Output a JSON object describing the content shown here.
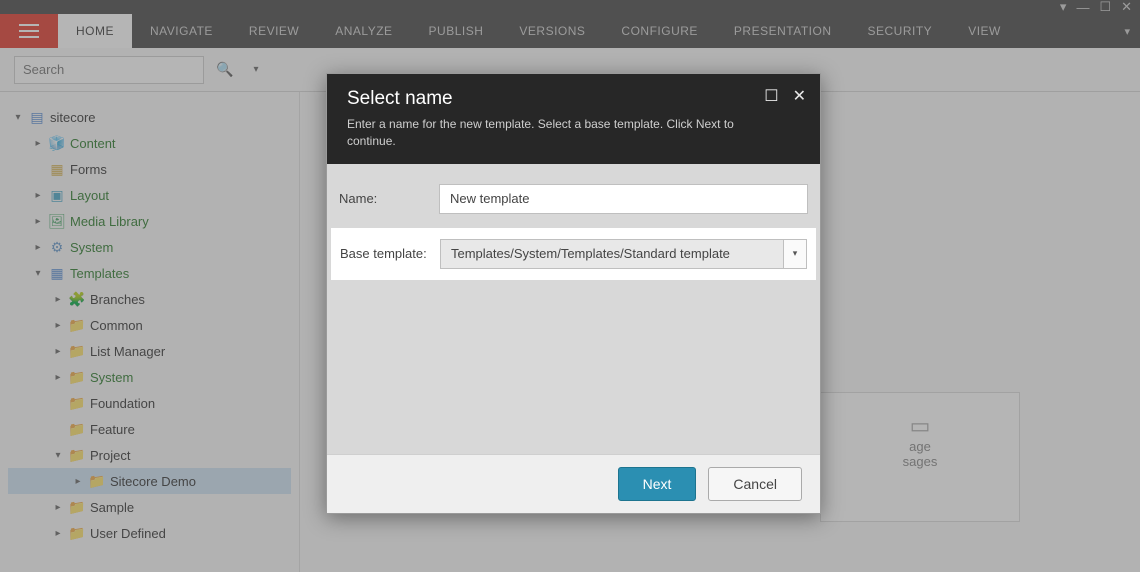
{
  "window": {
    "min": "—",
    "restore": "☐",
    "close": "✕",
    "drop": "▾"
  },
  "tabs": [
    "HOME",
    "NAVIGATE",
    "REVIEW",
    "ANALYZE",
    "PUBLISH",
    "VERSIONS",
    "CONFIGURE",
    "PRESENTATION",
    "SECURITY",
    "VIEW"
  ],
  "search": {
    "placeholder": "Search"
  },
  "tree": {
    "root": "sitecore",
    "content": "Content",
    "forms": "Forms",
    "layout": "Layout",
    "media": "Media Library",
    "system": "System",
    "templates": "Templates",
    "branches": "Branches",
    "common": "Common",
    "listmgr": "List Manager",
    "tsystem": "System",
    "foundation": "Foundation",
    "feature": "Feature",
    "project": "Project",
    "scdemo": "Sitecore Demo",
    "sample": "Sample",
    "userdef": "User Defined"
  },
  "bgcard": {
    "t1": "age",
    "t2": "sages"
  },
  "dialog": {
    "title": "Select name",
    "subtitle": "Enter a name for the new template. Select a base template. Click Next to continue.",
    "name_label": "Name:",
    "name_value": "New template",
    "base_label": "Base template:",
    "base_value": "Templates/System/Templates/Standard template",
    "next": "Next",
    "cancel": "Cancel"
  }
}
